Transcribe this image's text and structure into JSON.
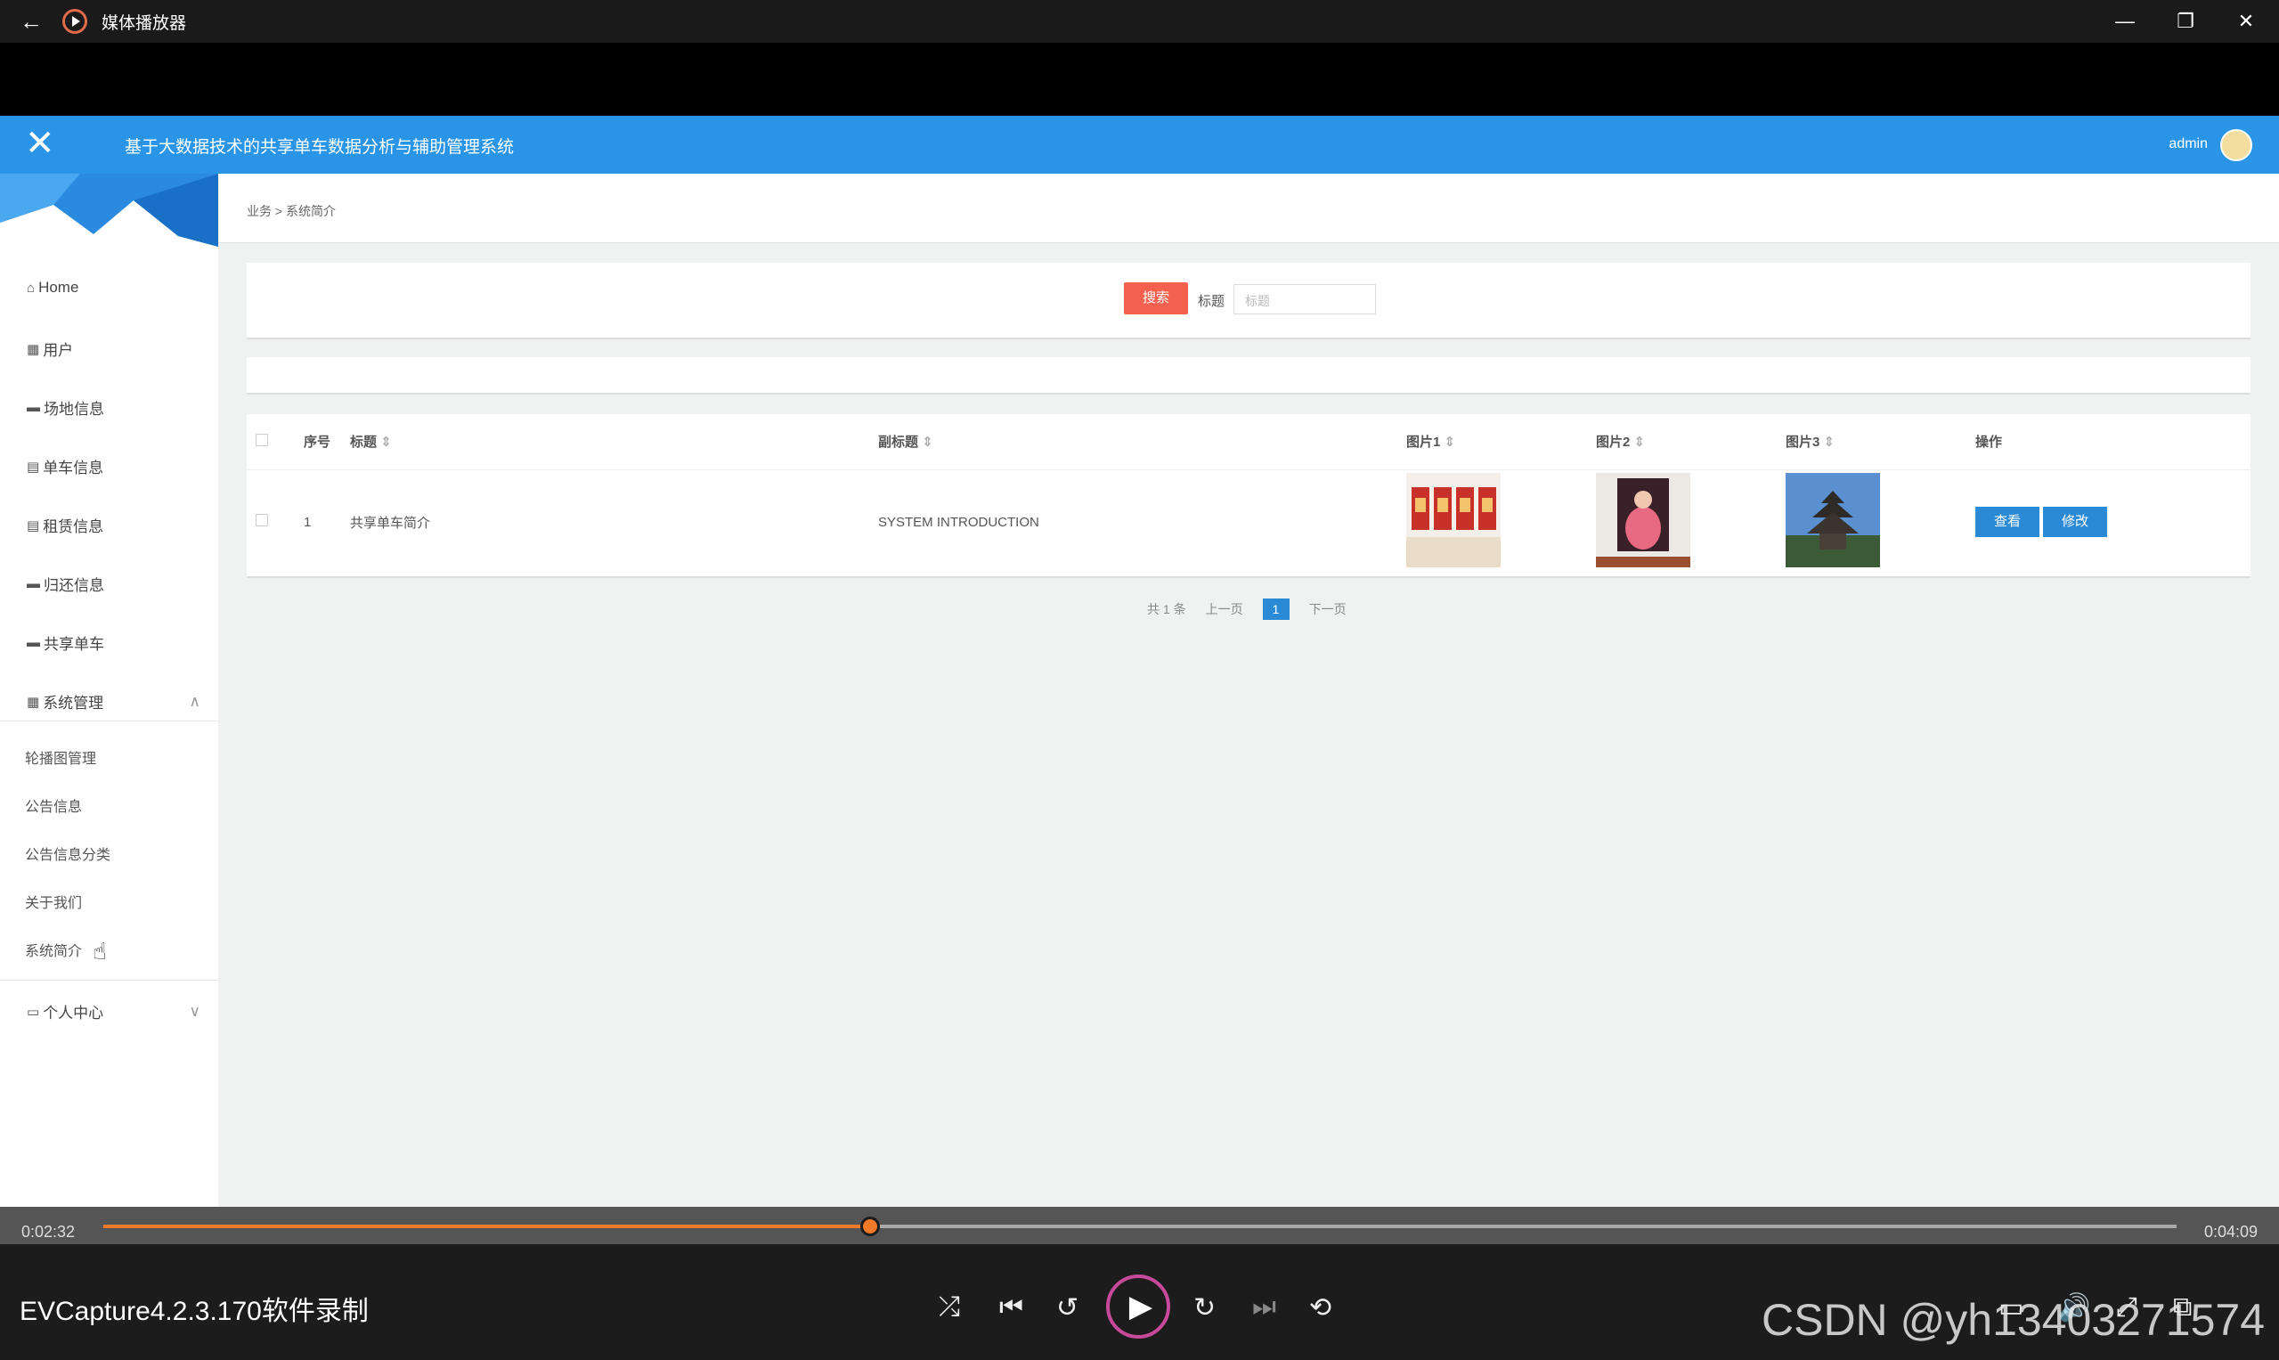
{
  "window": {
    "title": "媒体播放器",
    "back_icon": "back-arrow-icon",
    "controls": [
      "—",
      "❐",
      "✕"
    ]
  },
  "app": {
    "system_title": "基于大数据技术的共享单车数据分析与辅助管理系统",
    "close_glyph": "✕",
    "user": "admin",
    "accent": "#2a95e6"
  },
  "sidebar": {
    "items": [
      {
        "icon": "⌂",
        "label": "Home"
      },
      {
        "icon": "▦",
        "label": "用户"
      },
      {
        "icon": "▬",
        "label": "场地信息"
      },
      {
        "icon": "▤",
        "label": "单车信息"
      },
      {
        "icon": "▤",
        "label": "租赁信息"
      },
      {
        "icon": "▬",
        "label": "归还信息"
      },
      {
        "icon": "▬",
        "label": "共享单车"
      },
      {
        "icon": "▦",
        "label": "系统管理",
        "chevron": "∧"
      }
    ],
    "sub_items": [
      "轮播图管理",
      "公告信息",
      "公告信息分类",
      "关于我们",
      "系统简介"
    ],
    "personal": {
      "icon": "▭",
      "label": "个人中心",
      "chevron": "∨"
    }
  },
  "breadcrumb": "业务 > 系统简介",
  "search": {
    "button": "搜索",
    "label": "标题",
    "placeholder": "标题"
  },
  "table": {
    "headers": [
      "序号",
      "标题",
      "副标题",
      "图片1",
      "图片2",
      "图片3",
      "操作"
    ],
    "sort_glyph": "⇕",
    "rows": [
      {
        "index": "1",
        "title": "共享单车简介",
        "subtitle": "SYSTEM INTRODUCTION",
        "actions": [
          "查看",
          "修改"
        ]
      }
    ]
  },
  "pagination": {
    "total": "共 1 条",
    "prev": "上一页",
    "current": "1",
    "next": "下一页"
  },
  "player": {
    "elapsed": "0:02:32",
    "duration": "0:04:09",
    "progress": 0.37,
    "watermark_left": "EVCapture4.2.3.170软件录制",
    "watermark_right": "CSDN @yh13403271574",
    "progress_color": "#f07a2a"
  }
}
